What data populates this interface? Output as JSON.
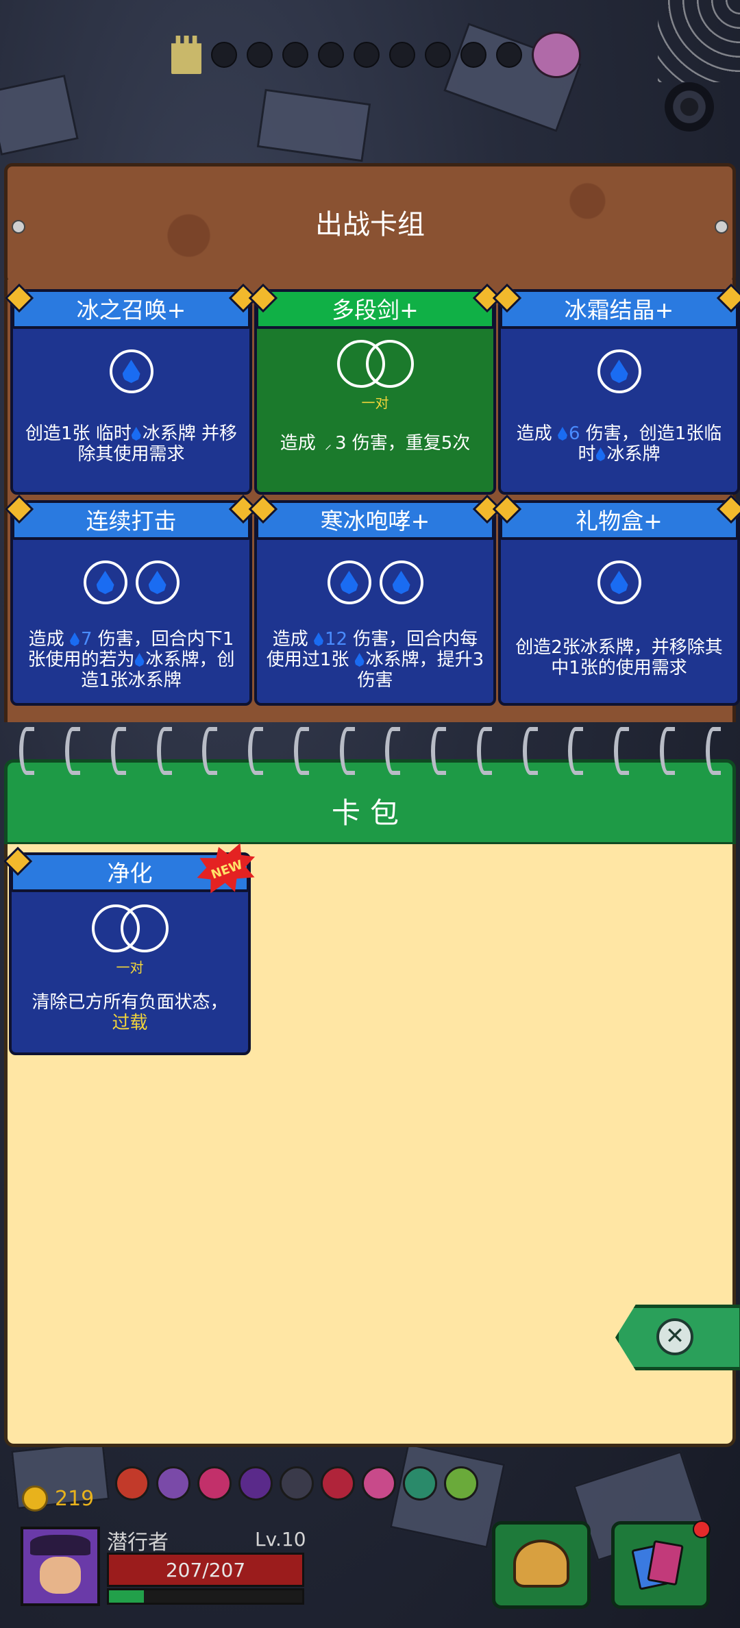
{
  "deck": {
    "title": "出战卡组",
    "cards": [
      {
        "name": "冰之召唤+",
        "style": "blue",
        "orbs": 1,
        "desc": [
          "创造1张 临时",
          "冰系牌 并移除其使用需求"
        ]
      },
      {
        "name": "多段剑+",
        "style": "green",
        "pair_label": "一对",
        "desc": [
          "造成 ",
          "3 伤害，重复5次"
        ]
      },
      {
        "name": "冰霜结晶+",
        "style": "blue",
        "orbs": 1,
        "desc": [
          "造成 ",
          "6",
          " 伤害，创造1张临时",
          "冰系牌"
        ]
      },
      {
        "name": "连续打击",
        "style": "blue",
        "orbs": 2,
        "desc": [
          "造成 ",
          "7",
          " 伤害，回合内下1张使用的若为",
          "冰系牌，创造1张冰系牌"
        ]
      },
      {
        "name": "寒冰咆哮+",
        "style": "blue",
        "orbs": 2,
        "desc": [
          "造成 ",
          "12",
          " 伤害，回合内每使用过1张 ",
          "冰系牌，提升3伤害"
        ]
      },
      {
        "name": "礼物盒+",
        "style": "blue",
        "orbs": 1,
        "desc": [
          "创造2张冰系牌，并移除其中1张的使用需求"
        ]
      }
    ]
  },
  "pack": {
    "title": "卡包",
    "cards": [
      {
        "name": "净化",
        "badge": "NEW",
        "pair_label": "一对",
        "desc": "清除已方所有负面状态，",
        "desc_highlight": "过载"
      }
    ]
  },
  "hud": {
    "gold": "219",
    "player_name": "潜行者",
    "level": "Lv.10",
    "hp": "207/207",
    "xp_fraction": 0.18
  },
  "icons": {
    "close": "close-icon",
    "settings": "gear-icon",
    "equipment": "helmet-icon",
    "cards": "cards-icon"
  },
  "colors": {
    "deck_card": "#1e3590",
    "deck_card_title": "#2a7ae0",
    "green_card": "#1b7a2c",
    "pack_background": "#ffe6a4",
    "wood": "#8a5232",
    "accent_gold": "#e8b21c",
    "hp_red": "#9b1c1c"
  }
}
